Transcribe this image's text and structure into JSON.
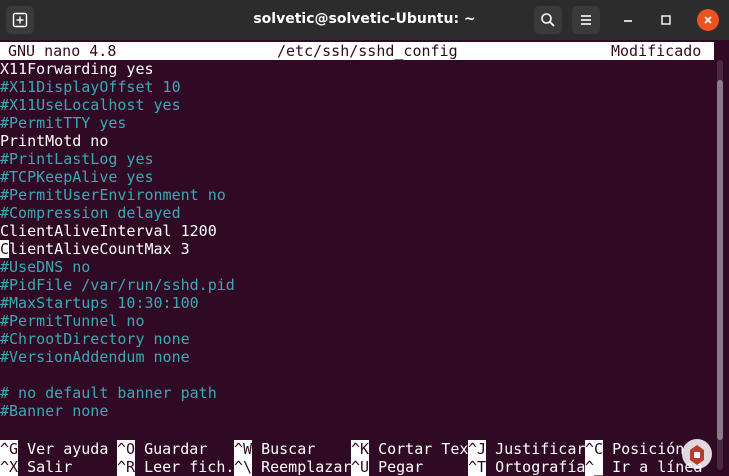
{
  "window": {
    "title": "solvetic@solvetic-Ubuntu: ~",
    "terminal_bg": "#300a24",
    "accent": "#e95420",
    "comment_color": "#3aa9b6"
  },
  "titlebar_icons": {
    "new_tab": "new-tab-icon",
    "search": "search-icon",
    "menu": "hamburger-menu-icon",
    "minimize": "minimize-icon",
    "maximize": "maximize-icon",
    "close": "close-icon"
  },
  "nano": {
    "version": "GNU nano 4.8",
    "file": "/etc/ssh/sshd_config",
    "status": "Modificado"
  },
  "lines": [
    {
      "text": "X11Forwarding yes",
      "comment": false
    },
    {
      "text": "#X11DisplayOffset 10",
      "comment": true
    },
    {
      "text": "#X11UseLocalhost yes",
      "comment": true
    },
    {
      "text": "#PermitTTY yes",
      "comment": true
    },
    {
      "text": "PrintMotd no",
      "comment": false
    },
    {
      "text": "#PrintLastLog yes",
      "comment": true
    },
    {
      "text": "#TCPKeepAlive yes",
      "comment": true
    },
    {
      "text": "#PermitUserEnvironment no",
      "comment": true
    },
    {
      "text": "#Compression delayed",
      "comment": true
    },
    {
      "text": "ClientAliveInterval 1200",
      "comment": false
    },
    {
      "text": "ClientAliveCountMax 3",
      "comment": false,
      "cursor": true
    },
    {
      "text": "#UseDNS no",
      "comment": true
    },
    {
      "text": "#PidFile /var/run/sshd.pid",
      "comment": true
    },
    {
      "text": "#MaxStartups 10:30:100",
      "comment": true
    },
    {
      "text": "#PermitTunnel no",
      "comment": true
    },
    {
      "text": "#ChrootDirectory none",
      "comment": true
    },
    {
      "text": "#VersionAddendum none",
      "comment": true
    },
    {
      "text": "",
      "comment": false
    },
    {
      "text": "# no default banner path",
      "comment": true
    },
    {
      "text": "#Banner none",
      "comment": true
    }
  ],
  "shortcuts_row1": [
    {
      "key": "^G",
      "label": " Ver ayuda"
    },
    {
      "key": "^O",
      "label": " Guardar"
    },
    {
      "key": "^W",
      "label": " Buscar"
    },
    {
      "key": "^K",
      "label": " Cortar Tex"
    },
    {
      "key": "^J",
      "label": " Justificar"
    },
    {
      "key": "^C",
      "label": " Posición"
    }
  ],
  "shortcuts_row2": [
    {
      "key": "^X",
      "label": " Salir"
    },
    {
      "key": "^R",
      "label": " Leer fich."
    },
    {
      "key": "^\\",
      "label": " Reemplazar"
    },
    {
      "key": "^U",
      "label": " Pegar"
    },
    {
      "key": "^T",
      "label": " Ortografía"
    },
    {
      "key": "^_",
      "label": " Ir a línea"
    }
  ]
}
